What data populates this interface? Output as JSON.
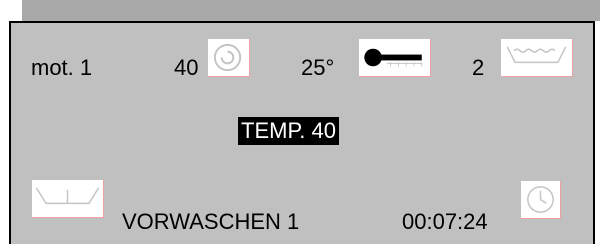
{
  "row1": {
    "motor_label": "mot. 1",
    "speed_value": "40",
    "speed_icon": "spin-icon",
    "temperature_value": "25°",
    "temperature_icon": "thermometer-icon",
    "level_value": "2",
    "level_icon": "water-level-icon"
  },
  "status": {
    "text": "TEMP. 40"
  },
  "row3": {
    "drum_icon": "drum-icon",
    "program_name": "VORWASCHEN 1",
    "time_value": "00:07:24",
    "clock_icon": "clock-icon"
  },
  "colors": {
    "screen_background": "#c0c0c0",
    "top_bar": "#a9a9a9",
    "highlight_background": "#000000",
    "highlight_text": "#ffffff",
    "icon_background": "#ffffff",
    "icon_line": "#b8b8b8"
  }
}
